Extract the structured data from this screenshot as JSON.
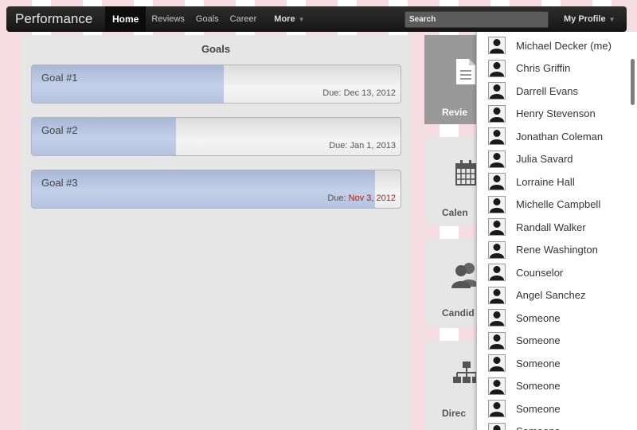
{
  "navbar": {
    "brand": "Performance",
    "items": [
      {
        "label": "Home"
      },
      {
        "label": "Reviews"
      },
      {
        "label": "Goals"
      },
      {
        "label": "Career"
      }
    ],
    "more_label": "More",
    "search_placeholder": "Search",
    "profile_label": "My Profile"
  },
  "goals": {
    "title": "Goals",
    "items": [
      {
        "label": "Goal #1",
        "due_prefix": "Due:",
        "due_date": "Dec 13, 2012",
        "overdue": false,
        "progress": 0.52
      },
      {
        "label": "Goal #2",
        "due_prefix": "Due:",
        "due_date": "Jan 1, 2013",
        "overdue": false,
        "progress": 0.39
      },
      {
        "label": "Goal #3",
        "due_prefix": "Due:",
        "due_date": "Nov 3, 2012",
        "overdue": true,
        "progress": 0.93
      }
    ]
  },
  "tiles": [
    {
      "label": "Revie",
      "icon": "document-icon",
      "active": true
    },
    {
      "label": "Calen",
      "icon": "calendar-icon",
      "active": false
    },
    {
      "label": "Candid",
      "icon": "people-icon",
      "active": false
    },
    {
      "label": "Direc",
      "icon": "org-chart-icon",
      "active": false
    }
  ],
  "profile_menu": {
    "items": [
      {
        "name": "Michael Decker (me)"
      },
      {
        "name": "Chris Griffin"
      },
      {
        "name": "Darrell Evans"
      },
      {
        "name": "Henry Stevenson"
      },
      {
        "name": "Jonathan Coleman"
      },
      {
        "name": "Julia Savard"
      },
      {
        "name": "Lorraine Hall"
      },
      {
        "name": "Michelle Campbell"
      },
      {
        "name": "Randall Walker"
      },
      {
        "name": "Rene Washington"
      },
      {
        "name": "Counselor"
      },
      {
        "name": "Angel Sanchez"
      },
      {
        "name": "Someone"
      },
      {
        "name": "Someone"
      },
      {
        "name": "Someone"
      },
      {
        "name": "Someone"
      },
      {
        "name": "Someone"
      },
      {
        "name": "Someone"
      }
    ]
  },
  "colors": {
    "navbar": "#1f1f1f",
    "progress_fill": "#b5c3df",
    "overdue": "#b01a1a",
    "active_tile": "#999999"
  }
}
